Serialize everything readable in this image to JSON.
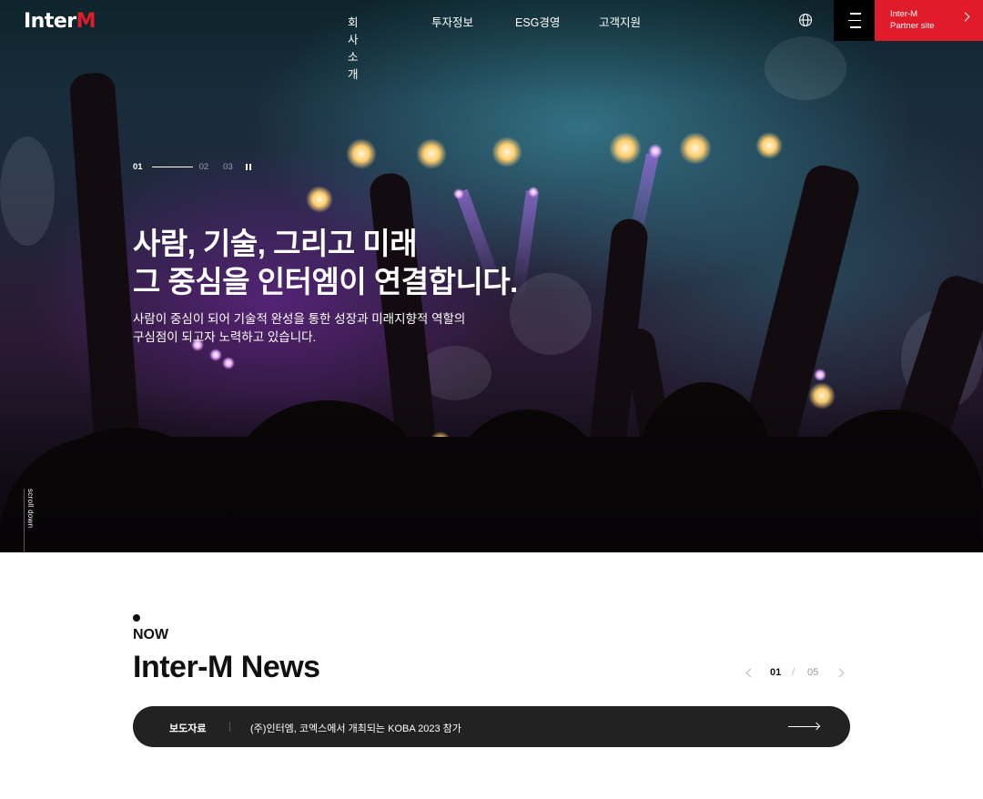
{
  "header": {
    "logo_text_1": "Inter",
    "logo_text_2": "M",
    "nav": [
      "회사소개",
      "투자정보",
      "ESG경영",
      "고객지원"
    ],
    "partner_line1": "Inter-M",
    "partner_line2": "Partner site",
    "accent": "#e11c2a"
  },
  "hero": {
    "pager": [
      "01",
      "02",
      "03"
    ],
    "active_slide": "01",
    "title": "사람, 기술, 그리고 미래\n그 중심을 인터엠이 연결합니다.",
    "description": "사람이 중심이 되어 기술적 완성을 통한 성장과 미래지향적 역할의\n구심점이 되고자 노력하고 있습니다.",
    "scroll_label": "scroll down"
  },
  "news": {
    "eyebrow": "NOW",
    "title": "Inter-M News",
    "current_page": "01",
    "separator": "/",
    "total_pages": "05",
    "item_category": "보도자료",
    "item_headline": "(주)인터엠, 코엑스에서 개최되는 KOBA 2023 참가"
  }
}
